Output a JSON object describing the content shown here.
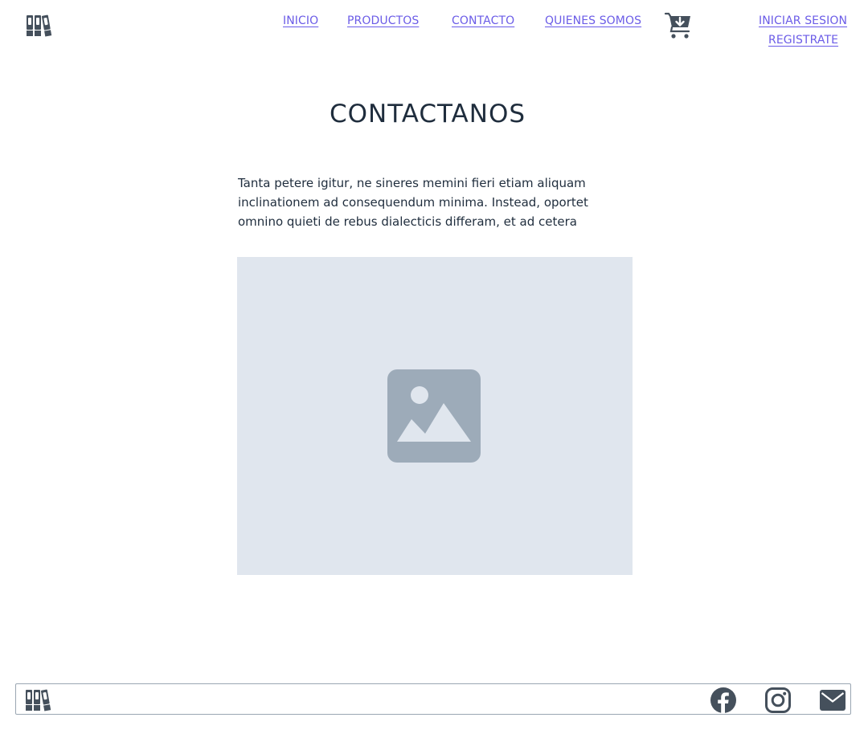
{
  "header": {
    "logo_icon": "books-icon",
    "nav": {
      "inicio": "INICIO",
      "productos": "PRODUCTOS",
      "contacto": "CONTACTO",
      "quienes_somos": "QUIENES SOMOS"
    },
    "cart_icon": "cart-plus-icon",
    "auth": {
      "login": "INICIAR SESION",
      "register": "REGISTRATE"
    }
  },
  "main": {
    "title": "CONTACTANOS",
    "intro_text": "Tanta petere igitur, ne sineres memini fieri etiam aliquam inclinationem ad consequendum minima. Instead, oportet omnino quieti de rebus dialecticis differam, et ad cetera",
    "image_placeholder_icon": "image-icon"
  },
  "footer": {
    "logo_icon": "books-icon",
    "social": [
      "facebook-icon",
      "instagram-icon",
      "mail-icon"
    ]
  },
  "colors": {
    "link": "#6b5ce7",
    "text": "#1f2d3d",
    "icon": "#45505c",
    "placeholder_bg": "#e0e6ee",
    "placeholder_icon": "#9dabb9"
  }
}
